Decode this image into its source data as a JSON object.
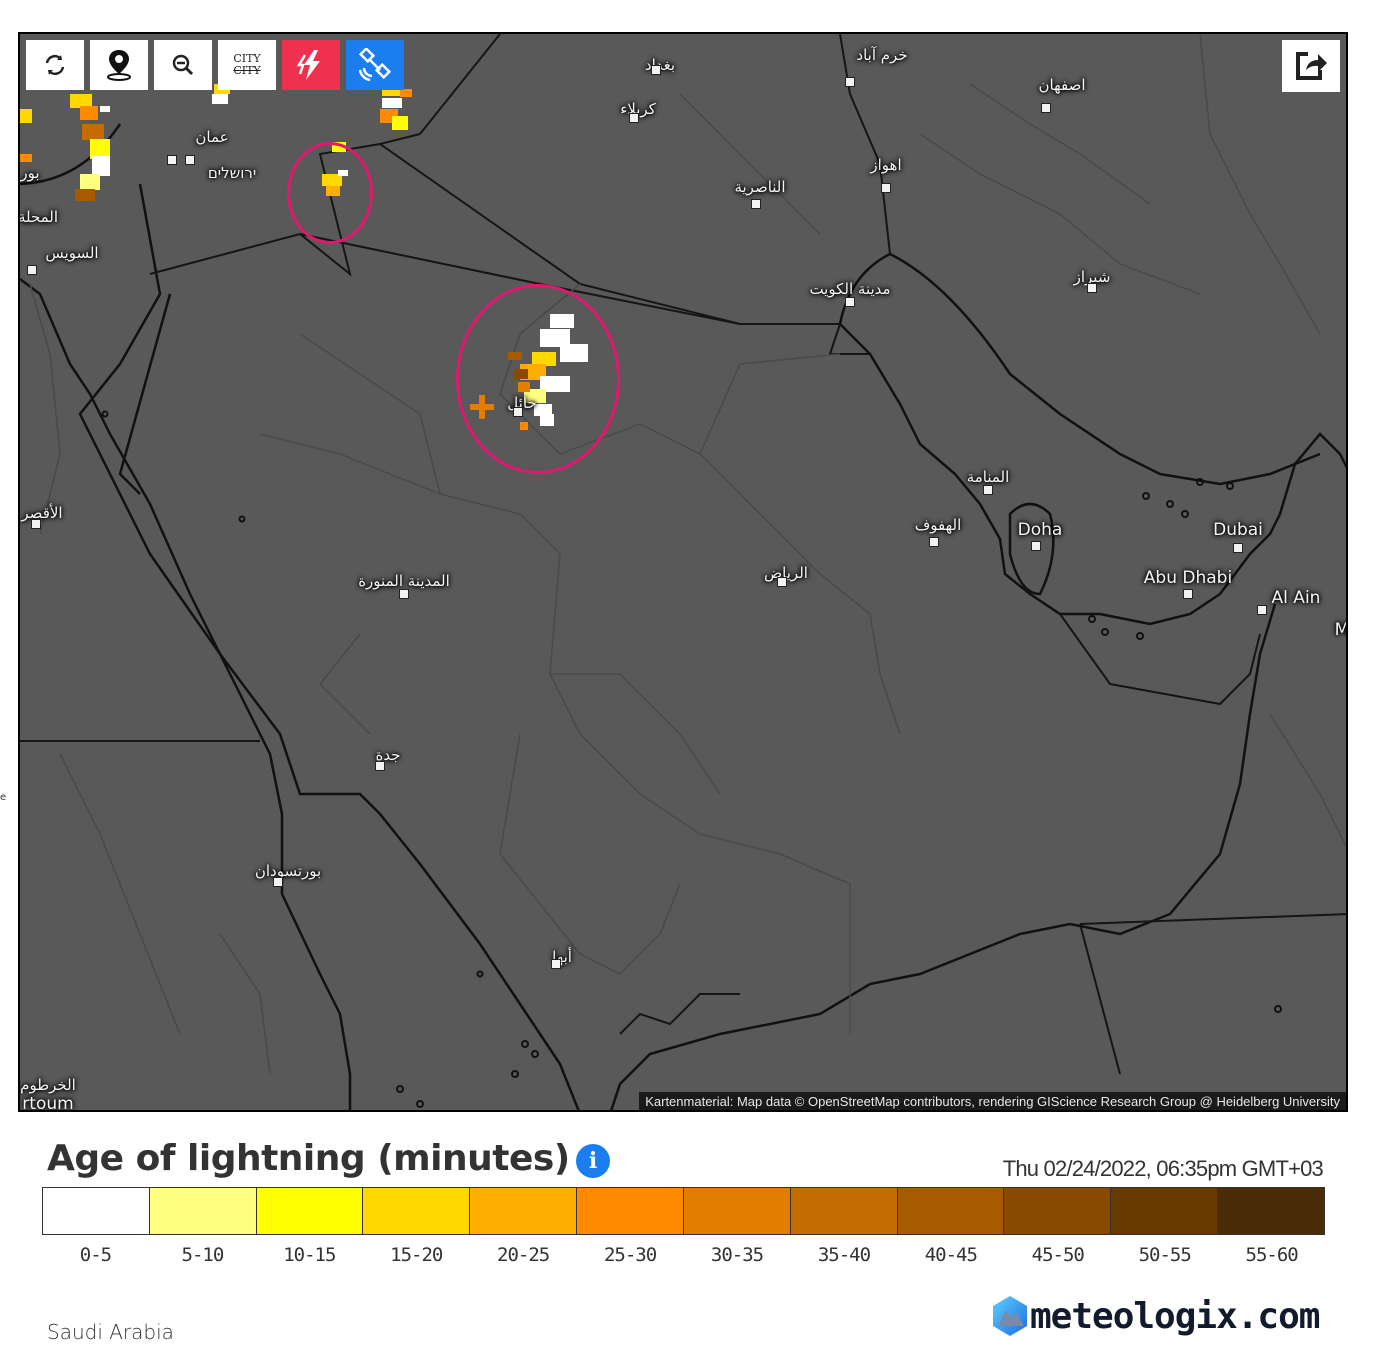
{
  "map": {
    "toolbar": {
      "refresh_label": "refresh",
      "locate_label": "locate",
      "zoom_out_label": "zoom out",
      "city_toggle": {
        "top": "CITY",
        "bottom": "CITY"
      },
      "lightning_label": "lightning",
      "satellite_label": "satellite"
    },
    "share_label": "share",
    "colors": {
      "lightning_button": "#f0304f",
      "satellite_button": "#1a7ef0",
      "highlight_circle": "#e0186f",
      "map_background": "#595959"
    },
    "cities": [
      {
        "name": "بغداد"
      },
      {
        "name": "كربلاء"
      },
      {
        "name": "خرم آباد"
      },
      {
        "name": "اصفهان"
      },
      {
        "name": "اهواز"
      },
      {
        "name": "الناصرية"
      },
      {
        "name": "عمان"
      },
      {
        "name": "ירושלים"
      },
      {
        "name": "بور"
      },
      {
        "name": "المحلة"
      },
      {
        "name": "السويس"
      },
      {
        "name": "مدينة الكويت"
      },
      {
        "name": "شيراز"
      },
      {
        "name": "حائل"
      },
      {
        "name": "المنامة"
      },
      {
        "name": "الهفوف"
      },
      {
        "name": "Doha"
      },
      {
        "name": "Dubai"
      },
      {
        "name": "Abu Dhabi"
      },
      {
        "name": "Al Ain"
      },
      {
        "name": "الأقصر"
      },
      {
        "name": "المدينة المنورة"
      },
      {
        "name": "الرياض"
      },
      {
        "name": "جدة"
      },
      {
        "name": "بورتسودان"
      },
      {
        "name": "أبها"
      },
      {
        "name": "الخرطوم"
      },
      {
        "name": "rtoum"
      },
      {
        "name": "M"
      }
    ],
    "attribution": "Kartenmaterial: Map data © OpenStreetMap contributors, rendering GIScience Research Group @ Heidelberg University"
  },
  "legend": {
    "title": "Age of lightning (minutes)",
    "info_icon": "i",
    "timestamp": "Thu 02/24/2022, 06:35pm GMT+03",
    "bins": [
      {
        "label": "0-5",
        "color": "#ffffff"
      },
      {
        "label": "5-10",
        "color": "#ffff80"
      },
      {
        "label": "10-15",
        "color": "#ffff00"
      },
      {
        "label": "15-20",
        "color": "#ffd800"
      },
      {
        "label": "20-25",
        "color": "#ffae00"
      },
      {
        "label": "25-30",
        "color": "#ff8a00"
      },
      {
        "label": "30-35",
        "color": "#e27d00"
      },
      {
        "label": "35-40",
        "color": "#c46c00"
      },
      {
        "label": "40-45",
        "color": "#a65b00"
      },
      {
        "label": "45-50",
        "color": "#884a00"
      },
      {
        "label": "50-55",
        "color": "#683a00"
      },
      {
        "label": "55-60",
        "color": "#4a2c08"
      }
    ]
  },
  "footer": {
    "region": "Saudi Arabia",
    "brand": "meteologix.com"
  }
}
